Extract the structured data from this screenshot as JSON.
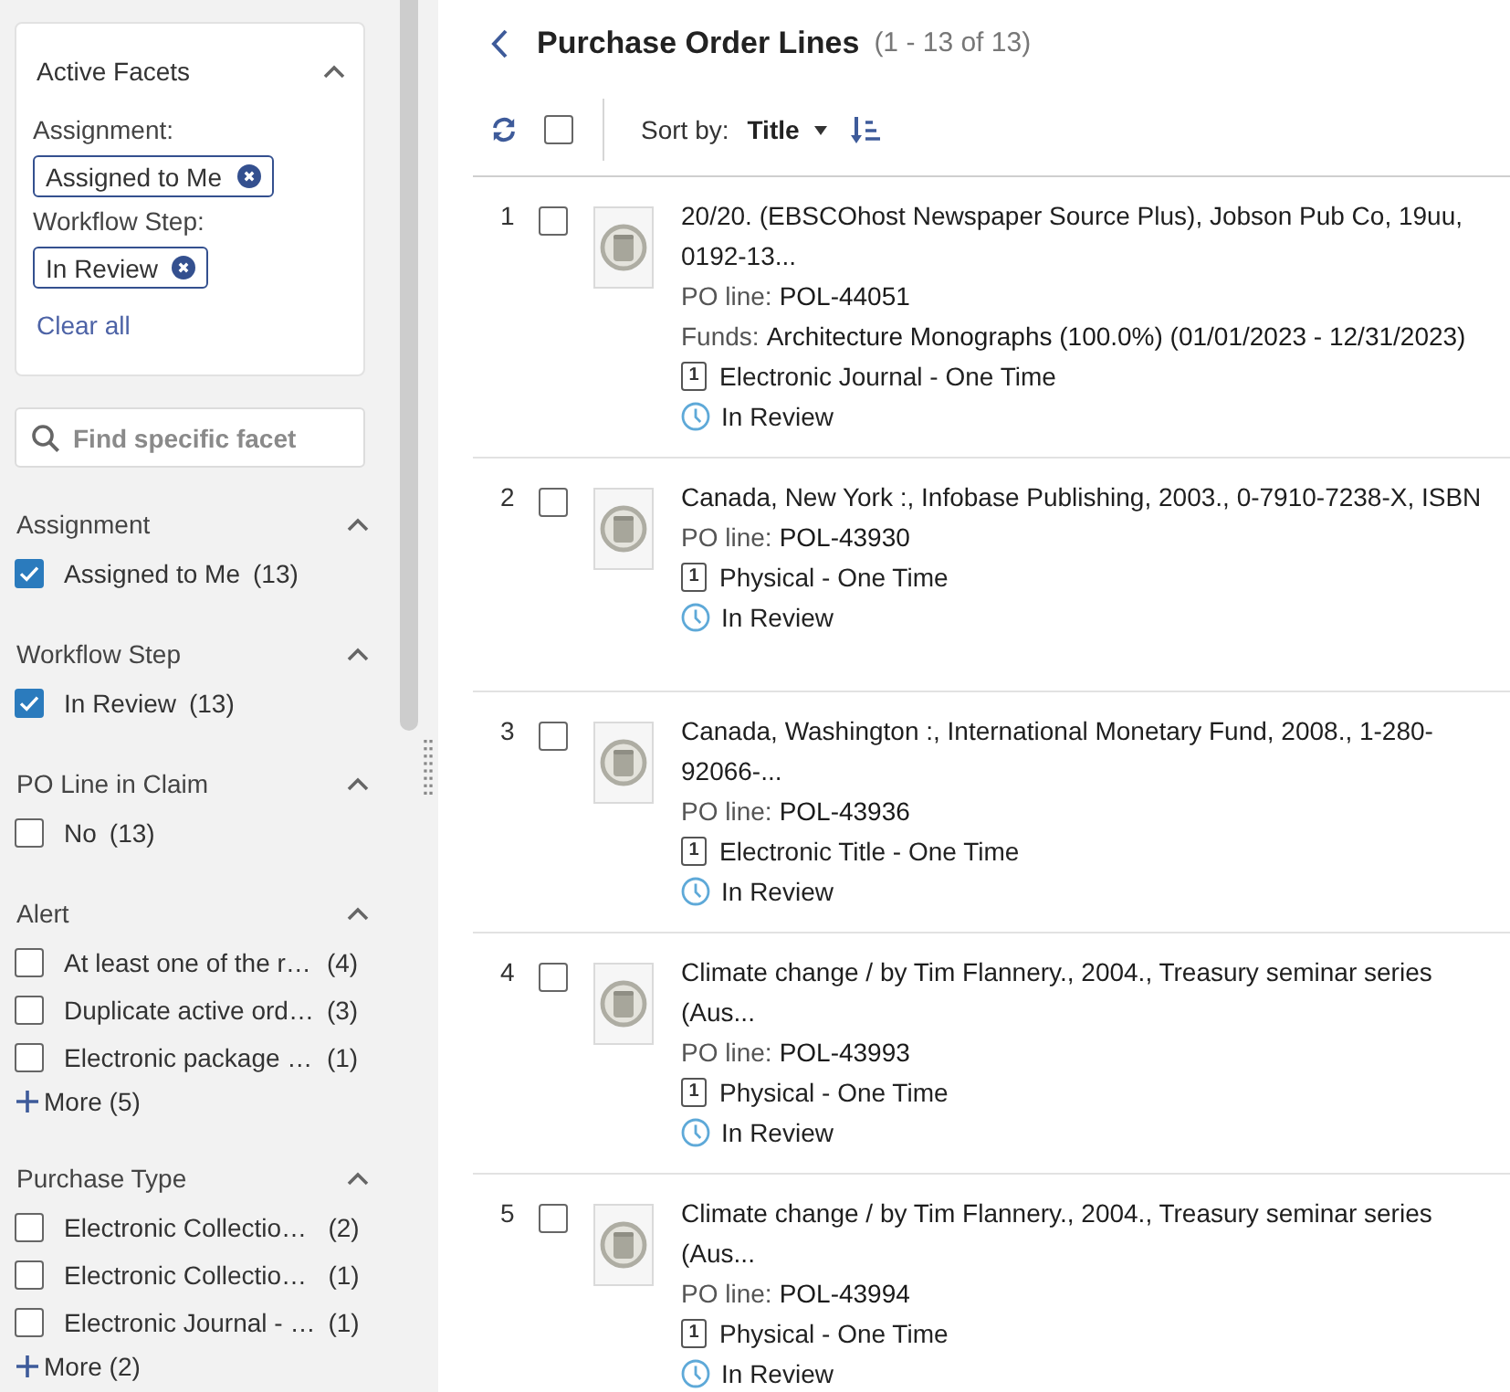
{
  "sidebar": {
    "active_facets": {
      "title": "Active Facets",
      "expanded": true,
      "groups": [
        {
          "label": "Assignment:",
          "chips": [
            "Assigned to Me"
          ]
        },
        {
          "label": "Workflow Step:",
          "chips": [
            "In Review"
          ]
        }
      ],
      "clear_all": "Clear all"
    },
    "facet_search": {
      "placeholder": "Find specific facet"
    },
    "facets": [
      {
        "title": "Assignment",
        "expanded": true,
        "items": [
          {
            "label": "Assigned to Me",
            "count": "(13)",
            "checked": true
          }
        ]
      },
      {
        "title": "Workflow Step",
        "expanded": true,
        "items": [
          {
            "label": "In Review",
            "count": "(13)",
            "checked": true
          }
        ]
      },
      {
        "title": "PO Line in Claim",
        "expanded": true,
        "items": [
          {
            "label": "No",
            "count": "(13)",
            "checked": false
          }
        ]
      },
      {
        "title": "Alert",
        "expanded": true,
        "items": [
          {
            "label": "At least one of the r…",
            "count": "(4)",
            "checked": false
          },
          {
            "label": "Duplicate active ord…",
            "count": "(3)",
            "checked": false
          },
          {
            "label": "Electronic package …",
            "count": "(1)",
            "checked": false
          }
        ],
        "more": "More (5)"
      },
      {
        "title": "Purchase Type",
        "expanded": true,
        "items": [
          {
            "label": "Electronic Collectio…",
            "count": "(2)",
            "checked": false
          },
          {
            "label": "Electronic Collectio…",
            "count": "(1)",
            "checked": false
          },
          {
            "label": "Electronic Journal - …",
            "count": "(1)",
            "checked": false
          }
        ],
        "more": "More (2)"
      }
    ]
  },
  "header": {
    "title": "Purchase Order Lines",
    "range": "(1 - 13 of 13)"
  },
  "toolbar": {
    "select_all": {
      "checked": false
    },
    "sort_label": "Sort by:",
    "sort_field": "Title"
  },
  "rows": [
    {
      "number": "1",
      "selected": false,
      "title": "20/20. (EBSCOhost Newspaper Source Plus), Jobson Pub Co, 19uu, 0192-13...",
      "fields": [
        {
          "label": "PO line:",
          "value": "POL-44051"
        },
        {
          "label": "Funds:",
          "value": "Architecture Monographs (100.0%) (01/01/2023 - 12/31/2023)"
        }
      ],
      "type_marker": "1",
      "type": "Electronic Journal - One Time",
      "status": "In Review"
    },
    {
      "number": "2",
      "selected": false,
      "title": "Canada, New York :, Infobase Publishing, 2003., 0-7910-7238-X, ISBN",
      "fields": [
        {
          "label": "PO line:",
          "value": "POL-43930"
        }
      ],
      "type_marker": "1",
      "type": "Physical - One Time",
      "status": "In Review"
    },
    {
      "number": "3",
      "selected": false,
      "title": "Canada, Washington :, International Monetary Fund, 2008., 1-280-92066-...",
      "fields": [
        {
          "label": "PO line:",
          "value": "POL-43936"
        }
      ],
      "type_marker": "1",
      "type": "Electronic Title - One Time",
      "status": "In Review"
    },
    {
      "number": "4",
      "selected": false,
      "title": "Climate change / by Tim Flannery., 2004., Treasury seminar series (Aus...",
      "fields": [
        {
          "label": "PO line:",
          "value": "POL-43993"
        }
      ],
      "type_marker": "1",
      "type": "Physical - One Time",
      "status": "In Review"
    },
    {
      "number": "5",
      "selected": false,
      "title": "Climate change / by Tim Flannery., 2004., Treasury seminar series (Aus...",
      "fields": [
        {
          "label": "PO line:",
          "value": "POL-43994"
        }
      ],
      "type_marker": "1",
      "type": "Physical - One Time",
      "status": "In Review"
    }
  ]
}
